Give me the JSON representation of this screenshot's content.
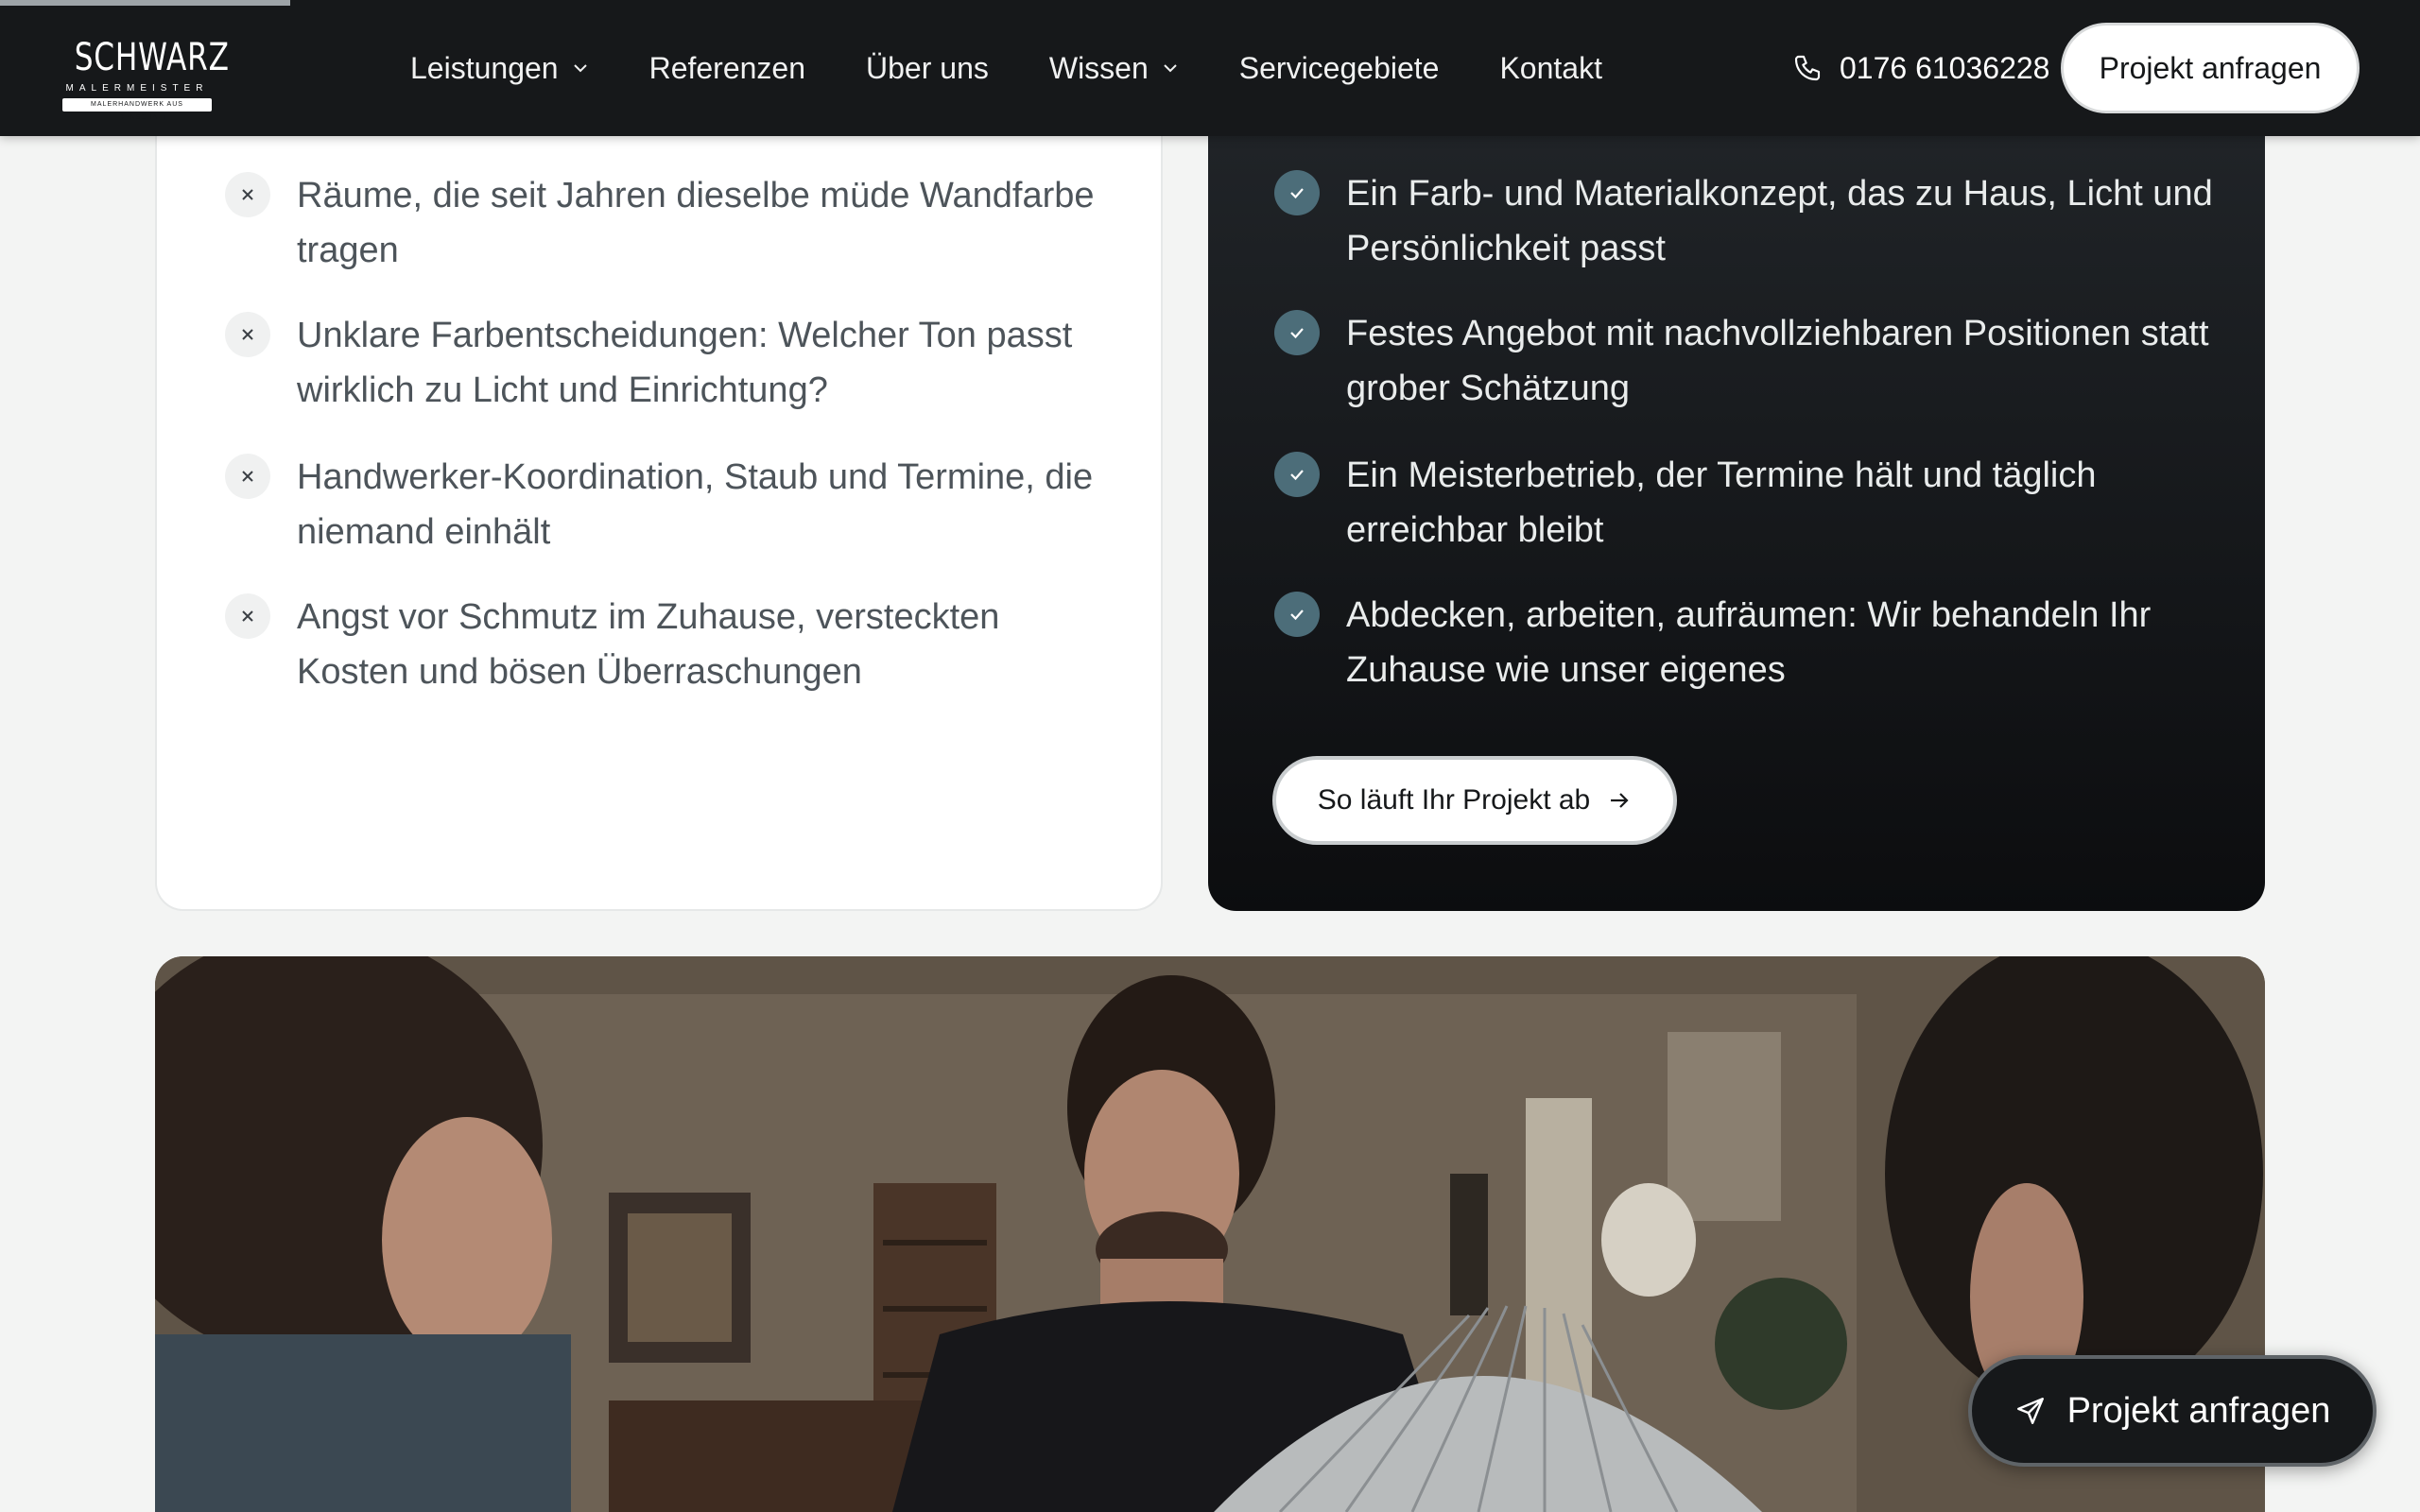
{
  "header": {
    "logo": {
      "brand": "SCHWARZ",
      "sub": "MALERMEISTER",
      "tagline": "MALERHANDWERK AUS LEIDENSCHAFT"
    },
    "nav": [
      {
        "label": "Leistungen",
        "has_dropdown": true
      },
      {
        "label": "Referenzen",
        "has_dropdown": false
      },
      {
        "label": "Über uns",
        "has_dropdown": false
      },
      {
        "label": "Wissen",
        "has_dropdown": true
      },
      {
        "label": "Servicegebiete",
        "has_dropdown": false
      },
      {
        "label": "Kontakt",
        "has_dropdown": false
      }
    ],
    "phone": "0176 61036228",
    "cta": "Projekt anfragen",
    "scroll_progress": 0.12
  },
  "problems": [
    "Räume, die seit Jahren dieselbe müde Wandfarbe tragen",
    "Unklare Farbentscheidungen: Welcher Ton passt wirklich zu Licht und Einrichtung?",
    "Handwerker-Koordination, Staub und Termine, die niemand einhält",
    "Angst vor Schmutz im Zuhause, versteckten Kosten und bösen Überraschungen"
  ],
  "solutions": [
    "Ein Farb- und Materialkonzept, das zu Haus, Licht und Persönlichkeit passt",
    "Festes Angebot mit nachvollziehbaren Positionen statt grober Schätzung",
    "Ein Meisterbetrieb, der Termine hält und täglich erreichbar bleibt",
    "Abdecken, arbeiten, aufräumen: Wir behandeln Ihr Zuhause wie unser eigenes"
  ],
  "process_button": "So läuft Ihr Projekt ab",
  "floating_cta": "Projekt anfragen",
  "colors": {
    "header_bg": "#16181a",
    "check_accent": "#4c6d79",
    "page_bg": "#f3f4f3"
  }
}
